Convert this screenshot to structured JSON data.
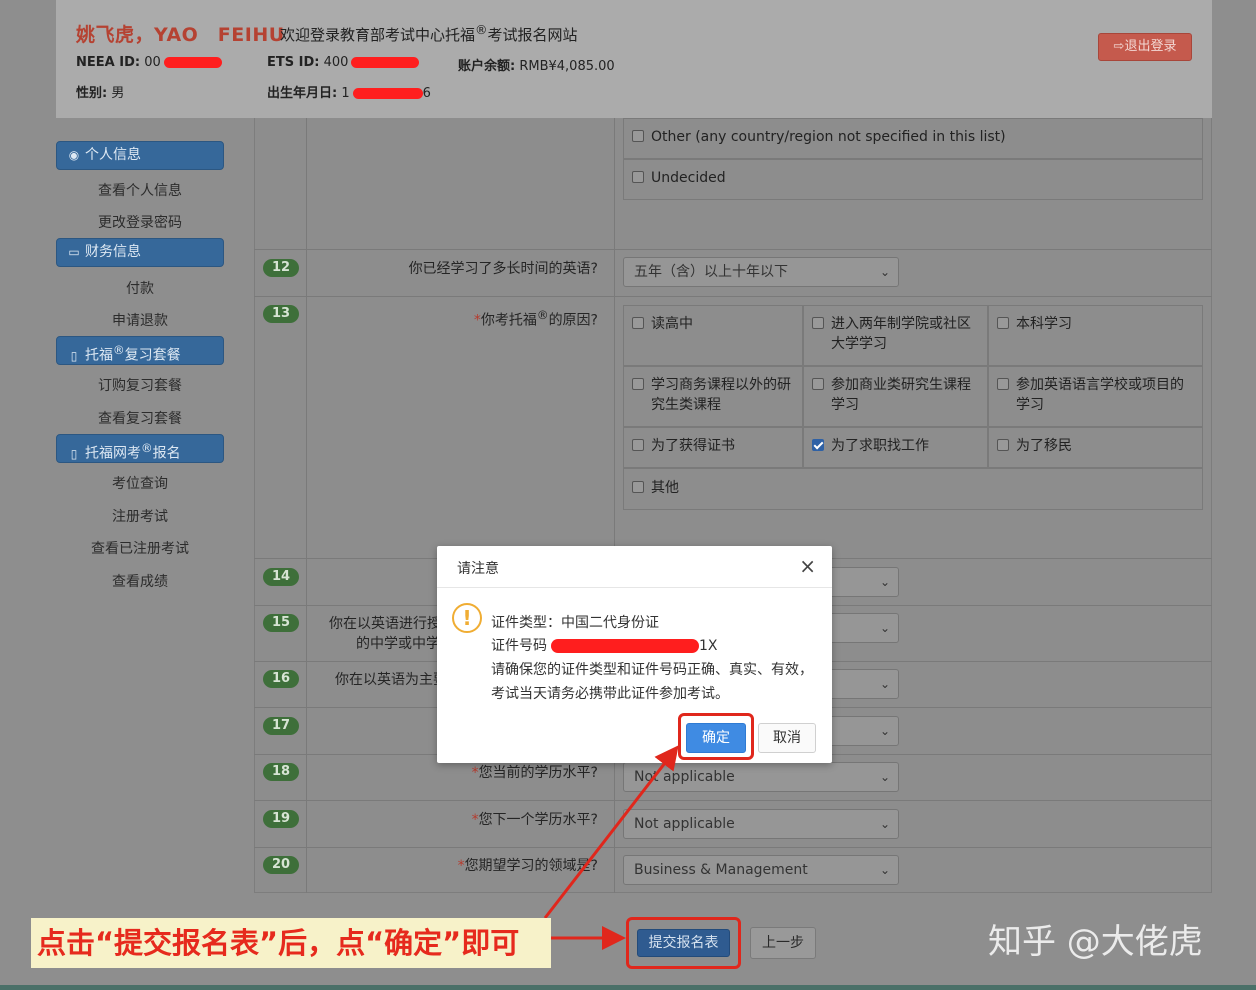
{
  "header": {
    "user_name": "姚飞虎，YAO　FEIHU",
    "welcome_prefix": "欢迎登录教育部考试中心托福",
    "welcome_reg": "®",
    "welcome_suffix": "考试报名网站",
    "neea_label": "NEEA ID:",
    "neea_value": "00",
    "ets_label": "ETS ID:",
    "ets_value": "400",
    "balance_label": "账户余额:",
    "balance_value": "RMB¥4,085.00",
    "gender_label": "性别:",
    "gender_value": "男",
    "birth_label": "出生年月日:",
    "birth_value": "1",
    "birth_tail": "6",
    "logout_label": "退出登录"
  },
  "sidebar": {
    "sections": [
      {
        "title": "个人信息",
        "icon": "user-icon",
        "items": [
          "查看个人信息",
          "更改登录密码"
        ]
      },
      {
        "title": "财务信息",
        "icon": "card-icon",
        "items": [
          "付款",
          "申请退款"
        ]
      },
      {
        "title_prefix": "托福",
        "title_reg": "®",
        "title_suffix": "复习套餐",
        "icon": "book-icon",
        "items": [
          "订购复习套餐",
          "查看复习套餐"
        ]
      },
      {
        "title_prefix": "托福网考",
        "title_reg": "®",
        "title_suffix": "报名",
        "icon": "book-icon",
        "items": [
          "考位查询",
          "注册考试",
          "查看已注册考试",
          "查看成绩"
        ]
      }
    ]
  },
  "form": {
    "top_options": [
      "Other (any country/region not specified in this list)",
      "Undecided"
    ],
    "q12": {
      "num": "12",
      "text": "你已经学习了多长时间的英语?",
      "value": "五年（含）以上十年以下"
    },
    "q13": {
      "num": "13",
      "req": "*",
      "text_prefix": "你考托福",
      "text_reg": "®",
      "text_suffix": "的原因?",
      "options": [
        {
          "line1": "读高中",
          "line2": "",
          "checked": false
        },
        {
          "line1": "进入两年制学院或社区",
          "line2": "大学学习",
          "checked": false
        },
        {
          "line1": "本科学习",
          "line2": "",
          "checked": false
        },
        {
          "line1": "学习商务课程以外的研",
          "line2": "究生类课程",
          "checked": false
        },
        {
          "line1": "参加商业类研究生课程",
          "line2": "学习",
          "checked": false
        },
        {
          "line1": "参加英语语言学校或项目的",
          "line2": "学习",
          "checked": false
        },
        {
          "line1": "为了获得证书",
          "line2": "",
          "checked": false
        },
        {
          "line1": "为了求职找工作",
          "line2": "",
          "checked": true
        },
        {
          "line1": "为了移民",
          "line2": "",
          "checked": false
        },
        {
          "line1": "其他",
          "line2": "",
          "checked": false
        }
      ]
    },
    "q14": {
      "num": "14"
    },
    "q15": {
      "num": "15",
      "line1": "你在以英语进行授",
      "line2": "的中学或中学"
    },
    "q16": {
      "num": "16",
      "text": "你在以英语为主要"
    },
    "q17": {
      "num": "17"
    },
    "q18": {
      "num": "18",
      "req": "*",
      "text": "您当前的学历水平?",
      "value": "Not applicable"
    },
    "q19": {
      "num": "19",
      "req": "*",
      "text": "您下一个学历水平?",
      "value": "Not applicable"
    },
    "q20": {
      "num": "20",
      "req": "*",
      "text": "您期望学习的领域是?",
      "value": "Business & Management"
    }
  },
  "buttons": {
    "submit": "提交报名表",
    "prev": "上一步"
  },
  "dialog": {
    "title": "请注意",
    "close": "×",
    "icon": "!",
    "line1": "证件类型：中国二代身份证",
    "line2_label": "证件号码",
    "line2_tail": "1X",
    "line3": "请确保您的证件类型和证件号码正确、真实、有效，",
    "line4": "考试当天请务必携带此证件参加考试。",
    "ok": "确定",
    "cancel": "取消"
  },
  "annotation": {
    "text": "点击“提交报名表”后，点“确定”即可",
    "watermark": "知乎 @大佬虎",
    "accent": "#e0271c"
  }
}
